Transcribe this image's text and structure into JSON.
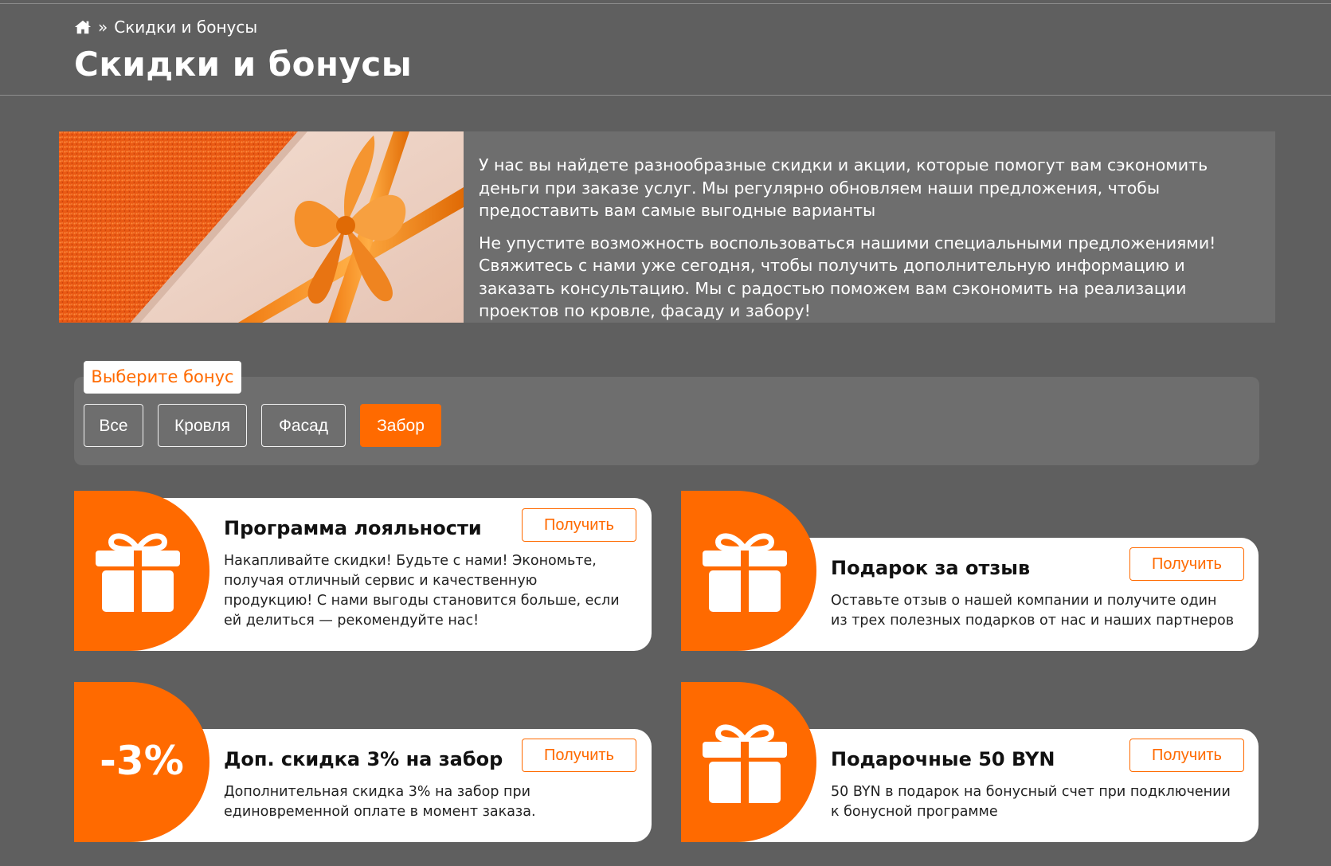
{
  "breadcrumb": {
    "home_icon": "home-icon",
    "separator": "»",
    "current": "Скидки и бонусы"
  },
  "page_title": "Скидки и бонусы",
  "banner": {
    "image": "gift-box-orange-ribbon",
    "paragraphs": [
      "У нас вы найдете разнообразные скидки и акции, которые помогут вам сэкономить деньги при заказе услуг. Мы регулярно обновляем наши предложения, чтобы предоставить вам самые выгодные варианты",
      "Не упустите возможность воспользоваться нашими специальными предложениями! Свяжитесь с нами уже сегодня, чтобы получить дополнительную информацию и заказать консультацию. Мы с радостью поможем вам сэкономить на реализации проектов по кровле, фасаду и забору!"
    ]
  },
  "filter": {
    "label": "Выберите бонус",
    "buttons": [
      "Все",
      "Кровля",
      "Фасад",
      "Забор"
    ],
    "active": "Забор"
  },
  "cards": [
    {
      "icon": "gift-icon",
      "title": "Программа лояльности",
      "description": "Накапливайте скидки! Будьте с нами! Экономьте, получая отличный сервис и качественную продукцию! С нами выгоды становится больше, если ей делиться — рекомендуйте нас!",
      "button": "Получить"
    },
    {
      "icon": "gift-icon",
      "title": "Подарок за отзыв",
      "description": "Оставьте отзыв о нашей компании и получите один из трех полезных подарков от нас и наших партнеров",
      "button": "Получить"
    },
    {
      "icon_text": "-3%",
      "title": "Доп. скидка 3% на забор",
      "description": "Дополнительная скидка 3% на забор при единовременной оплате в момент заказа.",
      "button": "Получить"
    },
    {
      "icon": "gift-icon",
      "title": "Подарочные 50 BYN",
      "description": "50 BYN в подарок на бонусный счет при подключении к бонусной программе",
      "button": "Получить"
    }
  ],
  "colors": {
    "accent": "#ff6a00",
    "background": "#5f5f5f",
    "panel": "#6e6e6e",
    "card": "#ffffff"
  }
}
